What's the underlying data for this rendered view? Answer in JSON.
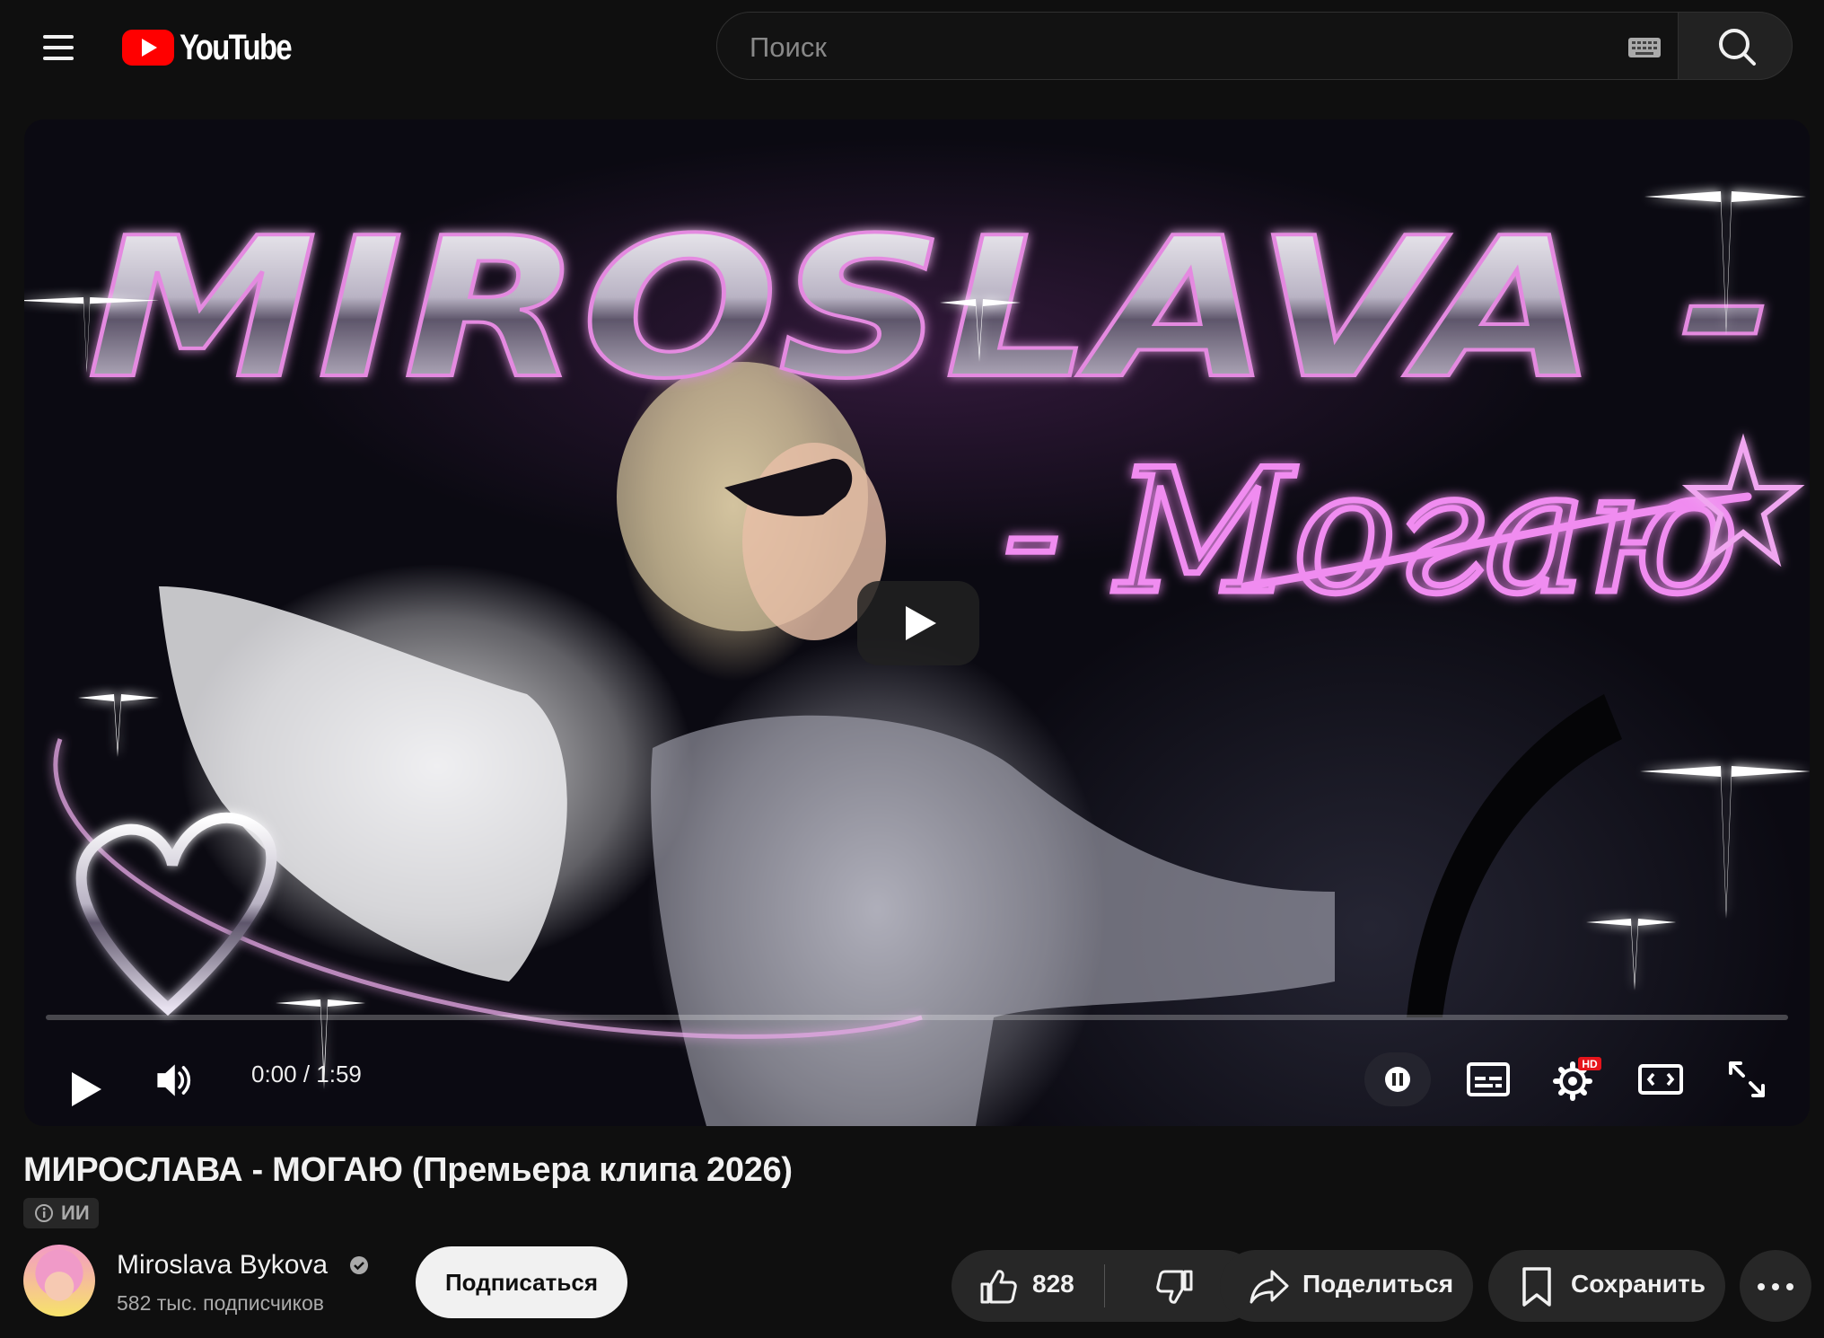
{
  "header": {
    "logo_text": "YouTube",
    "search_placeholder": "Поиск"
  },
  "player": {
    "time_display": "0:00 / 1:59",
    "hd_badge": "HD",
    "progress": 0,
    "thumbnail_text": {
      "artist": "MIROSLAVA -",
      "song": "- Могаю"
    }
  },
  "video": {
    "title": "МИРОСЛАВА - МОГАЮ (Премьера клипа 2026)",
    "ai_badge": "ИИ"
  },
  "channel": {
    "name": "Miroslava Bykova",
    "subscribers": "582 тыс. подписчиков",
    "subscribe_label": "Подписаться"
  },
  "actions": {
    "like_count": "828",
    "share_label": "Поделиться",
    "save_label": "Сохранить"
  },
  "colors": {
    "background": "#0f0f0f",
    "youtube_red": "#ff0000",
    "button_bg": "#272727",
    "neon_pink": "#e25adf"
  }
}
